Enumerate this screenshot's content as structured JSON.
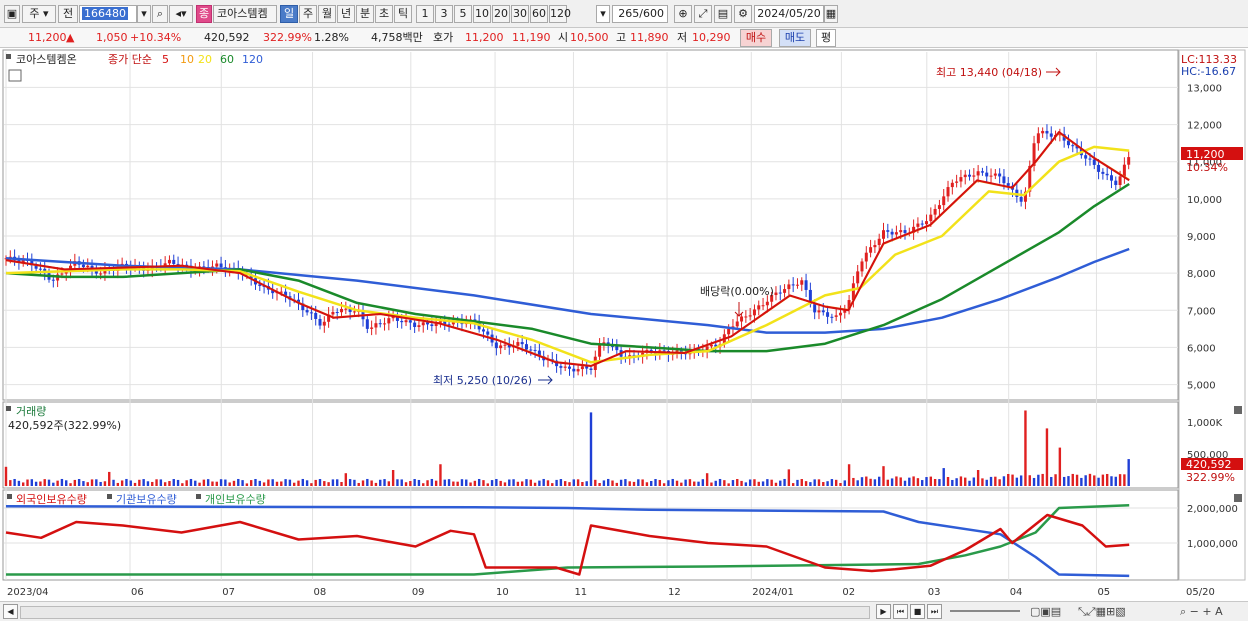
{
  "toolbar": {
    "market": "주",
    "prev_label": "전",
    "code": "166480",
    "badge": "종",
    "name": "코아스템켐",
    "periods": [
      "일",
      "주",
      "월",
      "년",
      "분",
      "초",
      "틱"
    ],
    "active_period": "일",
    "minutes": [
      "1",
      "3",
      "5",
      "10",
      "20",
      "30",
      "60",
      "120"
    ],
    "count": "265",
    "count_total": "/600",
    "date": "2024/05/20"
  },
  "quote": {
    "price": "11,200",
    "change": "1,050",
    "change_pct": "+10.34%",
    "volume": "420,592",
    "volume_ratio": "322.99%",
    "turnover": "1.28%",
    "amount": "4,758백만",
    "ask_label": "호가",
    "ask": "11,200",
    "bid": "11,190",
    "open_label": "시",
    "open": "10,500",
    "high_label": "고",
    "high": "11,890",
    "low_label": "저",
    "low": "10,290",
    "buy_label": "매수",
    "sell_label": "매도",
    "eval_label": "평"
  },
  "colors": {
    "up": "#e02020",
    "down": "#1f3fd6",
    "ma5": "#d41010",
    "ma10": "#f29a10",
    "ma20": "#f2e21a",
    "ma60": "#1a8a2a",
    "ma120": "#2f5dd6",
    "foreign": "#d41010",
    "institution": "#2f5dd6",
    "individual": "#2a9a4a"
  },
  "chart_data": [
    {
      "type": "candlestick",
      "title": "코아스템켐온",
      "indicator_label": "종가 단순",
      "ma_periods": [
        "5",
        "10",
        "20",
        "60",
        "120"
      ],
      "y_ticks": [
        "13,000",
        "12,000",
        "11,000",
        "10,000",
        "9,000",
        "8,000",
        "7,000",
        "6,000",
        "5,000"
      ],
      "ylim": [
        4800,
        13900
      ],
      "x_ticks": [
        "2023/04",
        "06",
        "07",
        "08",
        "09",
        "10",
        "11",
        "12",
        "2024/01",
        "02",
        "03",
        "04",
        "05",
        "05/20"
      ],
      "annotations": {
        "high": "최고 13,440 (04/18)",
        "low": "최저 5,250 (10/26)",
        "dividend": "배당락(0.00%)",
        "lc": "LC:113.33",
        "hc": "HC:-16.67",
        "last_price": "11,200",
        "last_pct": "10.34%"
      },
      "price_path": [
        [
          0,
          8400
        ],
        [
          0.02,
          8300
        ],
        [
          0.04,
          7800
        ],
        [
          0.06,
          8300
        ],
        [
          0.08,
          8000
        ],
        [
          0.1,
          8200
        ],
        [
          0.12,
          8100
        ],
        [
          0.14,
          8300
        ],
        [
          0.16,
          8100
        ],
        [
          0.18,
          8200
        ],
        [
          0.2,
          8050
        ],
        [
          0.22,
          7600
        ],
        [
          0.24,
          7400
        ],
        [
          0.26,
          6900
        ],
        [
          0.27,
          6600
        ],
        [
          0.28,
          7000
        ],
        [
          0.3,
          7000
        ],
        [
          0.31,
          6500
        ],
        [
          0.33,
          6800
        ],
        [
          0.35,
          6600
        ],
        [
          0.37,
          6650
        ],
        [
          0.4,
          6700
        ],
        [
          0.42,
          6000
        ],
        [
          0.44,
          6100
        ],
        [
          0.46,
          5700
        ],
        [
          0.48,
          5400
        ],
        [
          0.5,
          5450
        ],
        [
          0.51,
          6200
        ],
        [
          0.53,
          5700
        ],
        [
          0.55,
          5900
        ],
        [
          0.57,
          5850
        ],
        [
          0.59,
          5900
        ],
        [
          0.61,
          6100
        ],
        [
          0.62,
          6600
        ],
        [
          0.64,
          7000
        ],
        [
          0.66,
          7500
        ],
        [
          0.68,
          7800
        ],
        [
          0.69,
          7000
        ],
        [
          0.71,
          6800
        ],
        [
          0.72,
          7200
        ],
        [
          0.73,
          8300
        ],
        [
          0.75,
          9100
        ],
        [
          0.77,
          9100
        ],
        [
          0.79,
          9500
        ],
        [
          0.81,
          10500
        ],
        [
          0.83,
          10700
        ],
        [
          0.85,
          10600
        ],
        [
          0.86,
          10200
        ],
        [
          0.87,
          9900
        ],
        [
          0.88,
          11800
        ],
        [
          0.9,
          11700
        ],
        [
          0.92,
          11200
        ],
        [
          0.94,
          10600
        ],
        [
          0.95,
          10400
        ],
        [
          0.96,
          11200
        ]
      ],
      "ma5_path": [
        [
          0,
          8350
        ],
        [
          0.05,
          8100
        ],
        [
          0.1,
          8150
        ],
        [
          0.15,
          8200
        ],
        [
          0.2,
          8000
        ],
        [
          0.25,
          7200
        ],
        [
          0.28,
          6800
        ],
        [
          0.32,
          6900
        ],
        [
          0.37,
          6650
        ],
        [
          0.42,
          6200
        ],
        [
          0.47,
          5600
        ],
        [
          0.5,
          5500
        ],
        [
          0.53,
          5900
        ],
        [
          0.58,
          5850
        ],
        [
          0.62,
          6300
        ],
        [
          0.67,
          7400
        ],
        [
          0.7,
          7100
        ],
        [
          0.72,
          7000
        ],
        [
          0.75,
          8800
        ],
        [
          0.79,
          9300
        ],
        [
          0.83,
          10500
        ],
        [
          0.86,
          10300
        ],
        [
          0.88,
          11000
        ],
        [
          0.9,
          11800
        ],
        [
          0.93,
          11100
        ],
        [
          0.96,
          10500
        ]
      ],
      "ma20_path": [
        [
          0,
          8000
        ],
        [
          0.05,
          8050
        ],
        [
          0.1,
          8100
        ],
        [
          0.15,
          8100
        ],
        [
          0.2,
          8050
        ],
        [
          0.25,
          7500
        ],
        [
          0.3,
          7000
        ],
        [
          0.35,
          6800
        ],
        [
          0.4,
          6650
        ],
        [
          0.45,
          6200
        ],
        [
          0.5,
          5600
        ],
        [
          0.55,
          5800
        ],
        [
          0.6,
          5900
        ],
        [
          0.65,
          6600
        ],
        [
          0.7,
          7400
        ],
        [
          0.73,
          7600
        ],
        [
          0.76,
          8500
        ],
        [
          0.8,
          9000
        ],
        [
          0.84,
          10200
        ],
        [
          0.87,
          10100
        ],
        [
          0.9,
          11000
        ],
        [
          0.93,
          11400
        ],
        [
          0.96,
          11300
        ]
      ],
      "ma60_path": [
        [
          0,
          8000
        ],
        [
          0.05,
          7900
        ],
        [
          0.1,
          7900
        ],
        [
          0.15,
          8000
        ],
        [
          0.2,
          8100
        ],
        [
          0.25,
          7800
        ],
        [
          0.3,
          7200
        ],
        [
          0.35,
          6900
        ],
        [
          0.4,
          6700
        ],
        [
          0.45,
          6500
        ],
        [
          0.5,
          6100
        ],
        [
          0.55,
          6000
        ],
        [
          0.6,
          5900
        ],
        [
          0.65,
          5900
        ],
        [
          0.7,
          6100
        ],
        [
          0.75,
          6600
        ],
        [
          0.8,
          7300
        ],
        [
          0.85,
          8200
        ],
        [
          0.9,
          9100
        ],
        [
          0.93,
          9800
        ],
        [
          0.96,
          10400
        ]
      ],
      "ma120_path": [
        [
          0,
          8400
        ],
        [
          0.1,
          8200
        ],
        [
          0.2,
          8100
        ],
        [
          0.3,
          7800
        ],
        [
          0.4,
          7400
        ],
        [
          0.5,
          6900
        ],
        [
          0.6,
          6600
        ],
        [
          0.65,
          6400
        ],
        [
          0.7,
          6400
        ],
        [
          0.75,
          6500
        ],
        [
          0.8,
          6800
        ],
        [
          0.85,
          7300
        ],
        [
          0.9,
          7900
        ],
        [
          0.93,
          8300
        ],
        [
          0.96,
          8650
        ]
      ]
    },
    {
      "type": "bar",
      "title": "거래량",
      "value_label": "420,592주(322.99%)",
      "y_ticks": [
        "1,000K",
        "500,000"
      ],
      "ylim": [
        0,
        1100000
      ],
      "last_value": "420,592",
      "last_pct": "322.99%",
      "spikes": [
        [
          0.0,
          300000
        ],
        [
          0.09,
          220000
        ],
        [
          0.29,
          200000
        ],
        [
          0.33,
          250000
        ],
        [
          0.37,
          340000
        ],
        [
          0.5,
          1150000
        ],
        [
          0.6,
          200000
        ],
        [
          0.67,
          260000
        ],
        [
          0.72,
          340000
        ],
        [
          0.75,
          310000
        ],
        [
          0.8,
          280000
        ],
        [
          0.83,
          250000
        ],
        [
          0.87,
          1180000
        ],
        [
          0.89,
          900000
        ],
        [
          0.9,
          600000
        ],
        [
          0.96,
          420592
        ]
      ]
    },
    {
      "type": "line",
      "series": [
        {
          "name": "외국인보유수량"
        },
        {
          "name": "기관보유수량"
        },
        {
          "name": "개인보유수량"
        }
      ],
      "y_ticks": [
        "2,000,000",
        "1,000,000"
      ],
      "ylim": [
        0,
        2400000
      ],
      "foreign_path": [
        [
          0,
          1300000
        ],
        [
          0.03,
          1150000
        ],
        [
          0.06,
          1600000
        ],
        [
          0.1,
          1500000
        ],
        [
          0.15,
          1300000
        ],
        [
          0.2,
          1600000
        ],
        [
          0.25,
          1100000
        ],
        [
          0.3,
          1200000
        ],
        [
          0.35,
          900000
        ],
        [
          0.38,
          1350000
        ],
        [
          0.4,
          1250000
        ],
        [
          0.41,
          300000
        ],
        [
          0.47,
          300000
        ],
        [
          0.49,
          100000
        ],
        [
          0.5,
          1500000
        ],
        [
          0.55,
          1200000
        ],
        [
          0.6,
          1000000
        ],
        [
          0.65,
          900000
        ],
        [
          0.7,
          300000
        ],
        [
          0.74,
          200000
        ],
        [
          0.76,
          250000
        ],
        [
          0.79,
          350000
        ],
        [
          0.82,
          800000
        ],
        [
          0.85,
          1400000
        ],
        [
          0.86,
          1000000
        ],
        [
          0.89,
          1800000
        ],
        [
          0.92,
          1500000
        ],
        [
          0.94,
          900000
        ],
        [
          0.96,
          950000
        ]
      ],
      "institution_path": [
        [
          0,
          2050000
        ],
        [
          0.4,
          2020000
        ],
        [
          0.48,
          2000000
        ],
        [
          0.55,
          1950000
        ],
        [
          0.75,
          1900000
        ],
        [
          0.78,
          1600000
        ],
        [
          0.85,
          1250000
        ],
        [
          0.88,
          600000
        ],
        [
          0.9,
          100000
        ],
        [
          0.96,
          60000
        ]
      ],
      "individual_path": [
        [
          0,
          100000
        ],
        [
          0.4,
          100000
        ],
        [
          0.48,
          300000
        ],
        [
          0.6,
          330000
        ],
        [
          0.78,
          400000
        ],
        [
          0.82,
          650000
        ],
        [
          0.85,
          900000
        ],
        [
          0.88,
          1300000
        ],
        [
          0.9,
          2000000
        ],
        [
          0.96,
          2080000
        ]
      ]
    }
  ],
  "bottombar": {
    "nav": [
      "▶",
      "⏮",
      "■",
      "⏭"
    ]
  }
}
